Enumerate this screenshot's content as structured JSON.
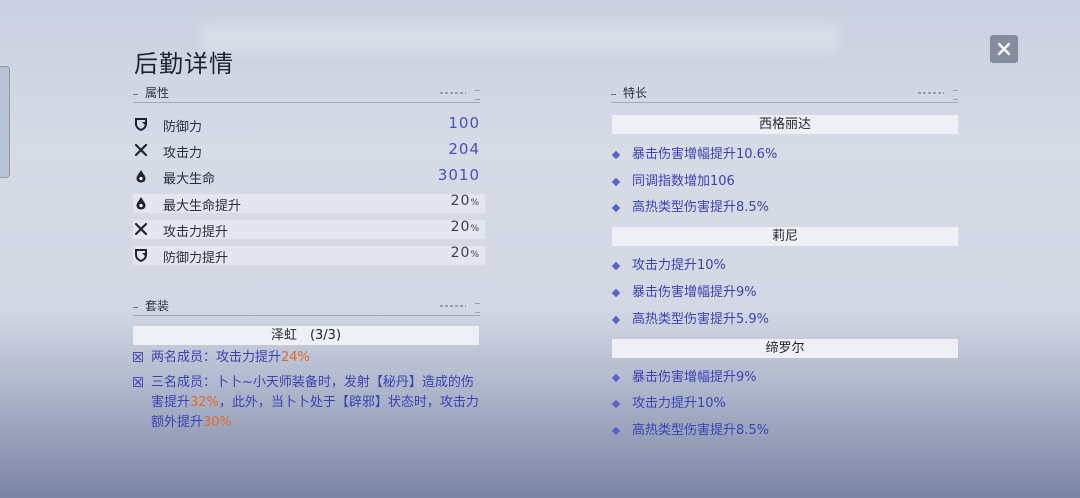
{
  "title": "后勤详情",
  "close_icon": "close-icon",
  "sections": {
    "attributes": {
      "label": "属性",
      "rows": [
        {
          "name": "防御力",
          "value": "100",
          "icon": "shield-icon"
        },
        {
          "name": "攻击力",
          "value": "204",
          "icon": "swords-icon"
        },
        {
          "name": "最大生命",
          "value": "3010",
          "icon": "drop-icon"
        },
        {
          "name": "最大生命提升",
          "value": "20",
          "unit": "%",
          "icon": "drop-icon"
        },
        {
          "name": "攻击力提升",
          "value": "20",
          "unit": "%",
          "icon": "swords-icon"
        },
        {
          "name": "防御力提升",
          "value": "20",
          "unit": "%",
          "icon": "shield-icon"
        }
      ]
    },
    "set": {
      "label": "套装",
      "name": "泽虹　(3/3)",
      "effects": [
        {
          "pre": "两名成员：攻击力提升",
          "hl": "24%",
          "post": ""
        },
        {
          "pre": "三名成员：卜卜~小天师装备时，发射【秘丹】造成的伤害提升",
          "hl": "32%",
          "post": "，此外，当卜卜处于【辟邪】状态时，攻击力额外提升",
          "hl2": "30%"
        }
      ]
    },
    "traits": {
      "label": "特长",
      "groups": [
        {
          "name": "西格丽达",
          "items": [
            "暴击伤害增幅提升10.6%",
            "同调指数增加106",
            "高热类型伤害提升8.5%"
          ]
        },
        {
          "name": "莉尼",
          "items": [
            "攻击力提升10%",
            "暴击伤害增幅提升9%",
            "高热类型伤害提升5.9%"
          ]
        },
        {
          "name": "缔罗尔",
          "items": [
            "暴击伤害增幅提升9%",
            "攻击力提升10%",
            "高热类型伤害提升8.5%"
          ]
        }
      ]
    }
  },
  "colors": {
    "accent": "#4a4ec0",
    "highlight": "#e06b28",
    "diamond": "#5a64c8"
  }
}
